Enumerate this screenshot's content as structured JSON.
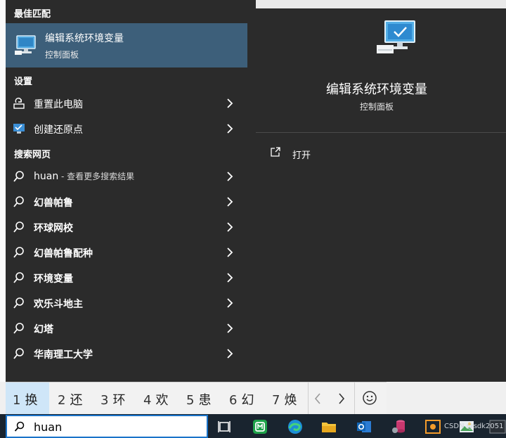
{
  "left": {
    "best_match_label": "最佳匹配",
    "best_match": {
      "title": "编辑系统环境变量",
      "subtitle": "控制面板",
      "icon": "monitor-settings-icon"
    },
    "settings_label": "设置",
    "settings_items": [
      {
        "label": "重置此电脑",
        "icon": "reset-pc-icon"
      },
      {
        "label": "创建还原点",
        "icon": "restore-point-icon"
      }
    ],
    "web_label": "搜索网页",
    "web_items": [
      {
        "label": "huan",
        "hint": " - 查看更多搜索结果",
        "icon": "search-icon"
      },
      {
        "label": "幻兽帕鲁",
        "icon": "search-icon"
      },
      {
        "label": "环球网校",
        "icon": "search-icon"
      },
      {
        "label": "幻兽帕鲁配种",
        "icon": "search-icon"
      },
      {
        "label": "环境变量",
        "icon": "search-icon"
      },
      {
        "label": "欢乐斗地主",
        "icon": "search-icon"
      },
      {
        "label": "幻塔",
        "icon": "search-icon"
      },
      {
        "label": "华南理工大学",
        "icon": "search-icon"
      }
    ]
  },
  "preview": {
    "title": "编辑系统环境变量",
    "subtitle": "控制面板",
    "open_label": "打开"
  },
  "ime": {
    "candidates": [
      {
        "num": "1",
        "text": "换",
        "selected": true
      },
      {
        "num": "2",
        "text": "还"
      },
      {
        "num": "3",
        "text": "环"
      },
      {
        "num": "4",
        "text": "欢"
      },
      {
        "num": "5",
        "text": "患"
      },
      {
        "num": "6",
        "text": "幻"
      },
      {
        "num": "7",
        "text": "焕"
      }
    ]
  },
  "taskbar": {
    "search_value": "huan",
    "icons": [
      "task-view-icon",
      "mindmaster-icon",
      "edge-icon",
      "file-explorer-icon",
      "outlook-icon",
      "database-tool-icon",
      "app-icon",
      "photos-icon"
    ],
    "watermark": "CSDN @sdk2051"
  },
  "colors": {
    "panel": "#2b2b2b",
    "highlight": "#3d5f7a",
    "taskbar": "#19242f",
    "ime_selected": "#cfe6f8"
  }
}
